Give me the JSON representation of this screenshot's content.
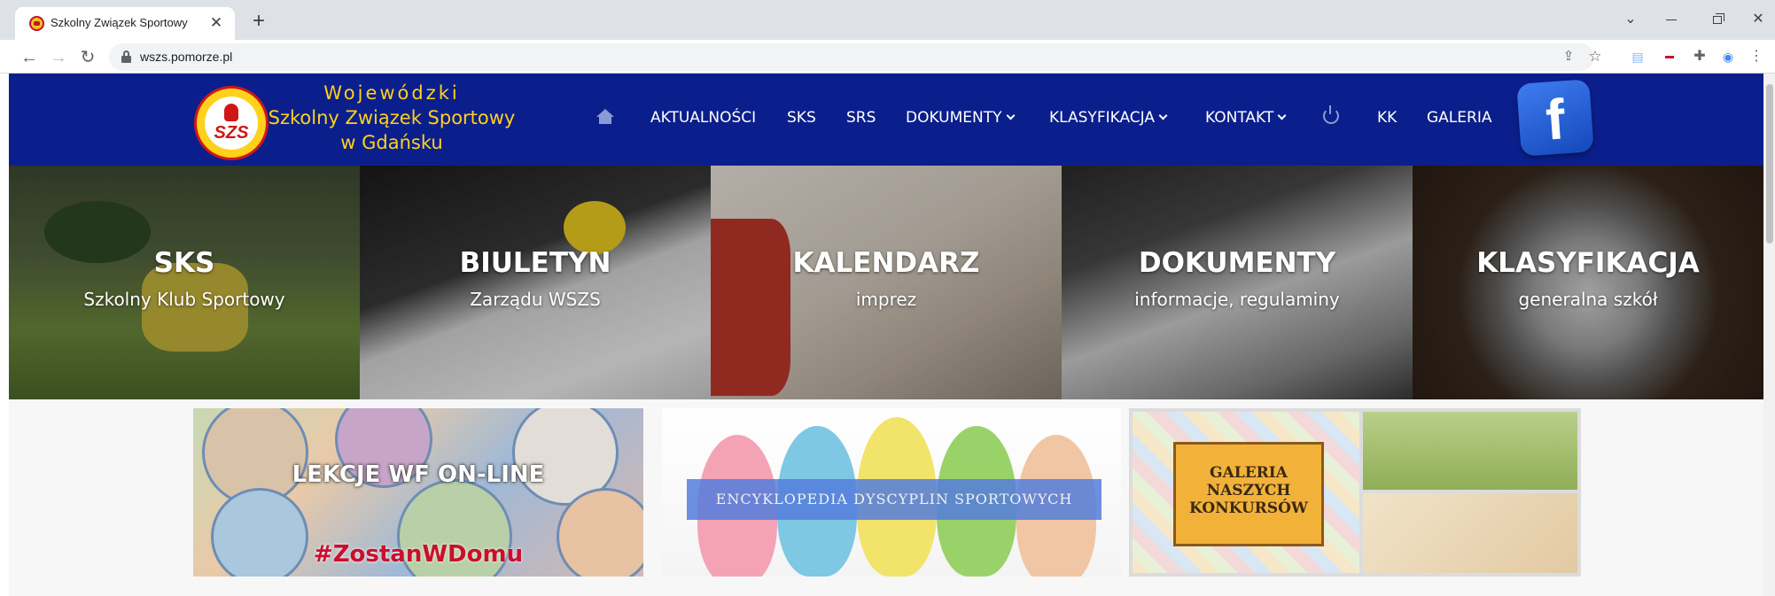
{
  "browser": {
    "tab_title": "Szkolny Związek Sportowy",
    "close_glyph": "✕",
    "new_tab_glyph": "+",
    "url": "wszs.pomorze.pl",
    "icons": [
      "back-icon",
      "forward-icon",
      "reload-icon",
      "lock-icon",
      "share-icon",
      "star-icon",
      "extensions-icon",
      "menu-icon"
    ]
  },
  "header": {
    "logo_text": "SZS",
    "brand_lines": [
      "Wojewódzki",
      "Szkolny Związek Sportowy",
      "w Gdańsku"
    ],
    "menu": [
      {
        "label": "AKTUALNOŚCI",
        "dropdown": false
      },
      {
        "label": "SKS",
        "dropdown": false
      },
      {
        "label": "SRS",
        "dropdown": false
      },
      {
        "label": "DOKUMENTY",
        "dropdown": true
      },
      {
        "label": "KLASYFIKACJA",
        "dropdown": true
      },
      {
        "label": "KONTAKT",
        "dropdown": true
      },
      {
        "label": "KK",
        "dropdown": false
      },
      {
        "label": "GALERIA",
        "dropdown": false
      }
    ],
    "facebook_glyph": "f",
    "colors": {
      "bar": "#0b1f8c",
      "brand": "#ffd11a"
    }
  },
  "tiles": [
    {
      "title": "SKS",
      "subtitle": "Szkolny Klub Sportowy"
    },
    {
      "title": "BIULETYN",
      "subtitle": "Zarządu WSZS"
    },
    {
      "title": "KALENDARZ",
      "subtitle": "imprez"
    },
    {
      "title": "DOKUMENTY",
      "subtitle": "informacje, regulaminy"
    },
    {
      "title": "KLASYFIKACJA",
      "subtitle": "generalna szkół"
    }
  ],
  "banners": {
    "lekcje": {
      "label": "LEKCJE WF ON-LINE",
      "hashtag": "#ZostanWDomu"
    },
    "encyklopedia": {
      "label": "ENCYKLOPEDIA DYSCYPLIN SPORTOWYCH"
    },
    "galeria": {
      "label_lines": [
        "GALERIA",
        "NASZYCH",
        "KONKURSÓW"
      ]
    }
  }
}
